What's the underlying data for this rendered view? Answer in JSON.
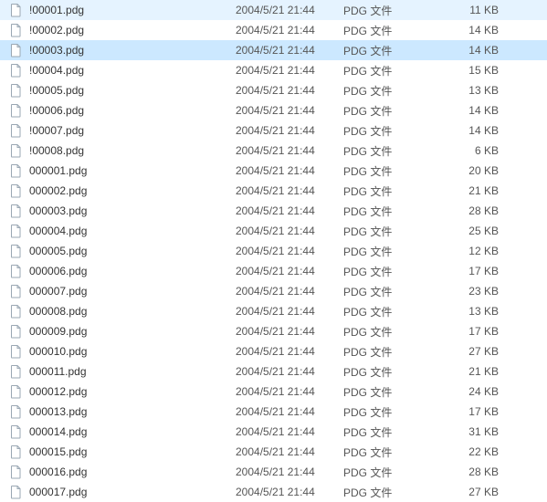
{
  "selected_index": 2,
  "files": [
    {
      "name": "!00001.pdg",
      "date": "2004/5/21 21:44",
      "type": "PDG 文件",
      "size": "11 KB"
    },
    {
      "name": "!00002.pdg",
      "date": "2004/5/21 21:44",
      "type": "PDG 文件",
      "size": "14 KB"
    },
    {
      "name": "!00003.pdg",
      "date": "2004/5/21 21:44",
      "type": "PDG 文件",
      "size": "14 KB"
    },
    {
      "name": "!00004.pdg",
      "date": "2004/5/21 21:44",
      "type": "PDG 文件",
      "size": "15 KB"
    },
    {
      "name": "!00005.pdg",
      "date": "2004/5/21 21:44",
      "type": "PDG 文件",
      "size": "13 KB"
    },
    {
      "name": "!00006.pdg",
      "date": "2004/5/21 21:44",
      "type": "PDG 文件",
      "size": "14 KB"
    },
    {
      "name": "!00007.pdg",
      "date": "2004/5/21 21:44",
      "type": "PDG 文件",
      "size": "14 KB"
    },
    {
      "name": "!00008.pdg",
      "date": "2004/5/21 21:44",
      "type": "PDG 文件",
      "size": "6 KB"
    },
    {
      "name": "000001.pdg",
      "date": "2004/5/21 21:44",
      "type": "PDG 文件",
      "size": "20 KB"
    },
    {
      "name": "000002.pdg",
      "date": "2004/5/21 21:44",
      "type": "PDG 文件",
      "size": "21 KB"
    },
    {
      "name": "000003.pdg",
      "date": "2004/5/21 21:44",
      "type": "PDG 文件",
      "size": "28 KB"
    },
    {
      "name": "000004.pdg",
      "date": "2004/5/21 21:44",
      "type": "PDG 文件",
      "size": "25 KB"
    },
    {
      "name": "000005.pdg",
      "date": "2004/5/21 21:44",
      "type": "PDG 文件",
      "size": "12 KB"
    },
    {
      "name": "000006.pdg",
      "date": "2004/5/21 21:44",
      "type": "PDG 文件",
      "size": "17 KB"
    },
    {
      "name": "000007.pdg",
      "date": "2004/5/21 21:44",
      "type": "PDG 文件",
      "size": "23 KB"
    },
    {
      "name": "000008.pdg",
      "date": "2004/5/21 21:44",
      "type": "PDG 文件",
      "size": "13 KB"
    },
    {
      "name": "000009.pdg",
      "date": "2004/5/21 21:44",
      "type": "PDG 文件",
      "size": "17 KB"
    },
    {
      "name": "000010.pdg",
      "date": "2004/5/21 21:44",
      "type": "PDG 文件",
      "size": "27 KB"
    },
    {
      "name": "000011.pdg",
      "date": "2004/5/21 21:44",
      "type": "PDG 文件",
      "size": "21 KB"
    },
    {
      "name": "000012.pdg",
      "date": "2004/5/21 21:44",
      "type": "PDG 文件",
      "size": "24 KB"
    },
    {
      "name": "000013.pdg",
      "date": "2004/5/21 21:44",
      "type": "PDG 文件",
      "size": "17 KB"
    },
    {
      "name": "000014.pdg",
      "date": "2004/5/21 21:44",
      "type": "PDG 文件",
      "size": "31 KB"
    },
    {
      "name": "000015.pdg",
      "date": "2004/5/21 21:44",
      "type": "PDG 文件",
      "size": "22 KB"
    },
    {
      "name": "000016.pdg",
      "date": "2004/5/21 21:44",
      "type": "PDG 文件",
      "size": "28 KB"
    },
    {
      "name": "000017.pdg",
      "date": "2004/5/21 21:44",
      "type": "PDG 文件",
      "size": "27 KB"
    }
  ]
}
